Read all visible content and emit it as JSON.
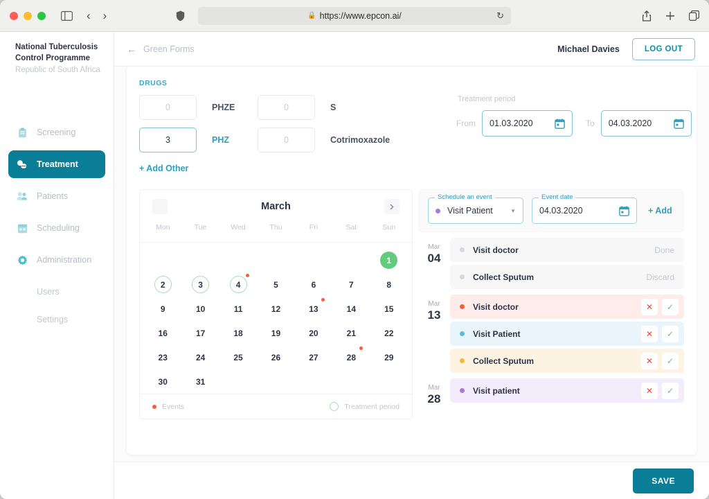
{
  "browser": {
    "url": "https://www.epcon.ai/",
    "lock_icon": "lock-icon",
    "shield_icon": "shield-icon",
    "sidebar_toggle_icon": "sidebar-toggle-icon",
    "back_icon": "chevron-left-icon",
    "forward_icon": "chevron-right-icon",
    "reload_icon": "reload-icon",
    "share_icon": "share-icon",
    "newtab_icon": "plus-icon",
    "tabs_icon": "tabs-icon"
  },
  "sidebar": {
    "brand_line1": "National Tuberculosis",
    "brand_line2": "Control Programme",
    "brand_sub": "Republic of South Africa",
    "items": [
      {
        "label": "Screening",
        "icon": "clipboard-icon",
        "active": false
      },
      {
        "label": "Treatment",
        "icon": "pills-icon",
        "active": true
      },
      {
        "label": "Patients",
        "icon": "users-icon",
        "active": false
      },
      {
        "label": "Scheduling",
        "icon": "calendar-icon",
        "active": false
      },
      {
        "label": "Administration",
        "icon": "gear-icon",
        "active": false
      }
    ],
    "subitems": [
      {
        "label": "Users"
      },
      {
        "label": "Settings"
      }
    ]
  },
  "topbar": {
    "back_label": "Green Forms",
    "back_icon": "arrow-left-icon",
    "username": "Michael Davies",
    "logout_label": "LOG OUT"
  },
  "drugs": {
    "section_label": "DRUGS",
    "rows": [
      {
        "value": "0",
        "placeholder": "0",
        "name": "PHZE",
        "filled": false,
        "accent": false
      },
      {
        "value": "3",
        "placeholder": "0",
        "name": "PHZ",
        "filled": true,
        "accent": true
      }
    ],
    "rows2": [
      {
        "value": "0",
        "placeholder": "0",
        "name": "S",
        "filled": false
      },
      {
        "value": "0",
        "placeholder": "0",
        "name": "Cotrimoxazole",
        "filled": false
      }
    ],
    "add_other_label": "+ Add Other"
  },
  "treatment_period": {
    "label": "Treatment period",
    "from_prefix": "From",
    "from_value": "01.03.2020",
    "to_prefix": "To",
    "to_value": "04.03.2020",
    "calendar_icon": "calendar-icon"
  },
  "calendar": {
    "month": "March",
    "prev_icon": "chevron-left-icon",
    "next_icon": "chevron-right-icon",
    "weekdays": [
      "Mon",
      "Tue",
      "Wed",
      "Thu",
      "Fri",
      "Sat",
      "Sun"
    ],
    "weeks": [
      [
        null,
        null,
        null,
        null,
        null,
        null,
        {
          "d": 1,
          "today": true,
          "range": false,
          "event": false
        }
      ],
      [
        {
          "d": 2,
          "range": true,
          "event": false
        },
        {
          "d": 3,
          "range": true,
          "event": false
        },
        {
          "d": 4,
          "range": true,
          "event": true
        },
        {
          "d": 5
        },
        {
          "d": 6
        },
        {
          "d": 7
        },
        {
          "d": 8
        }
      ],
      [
        {
          "d": 9
        },
        {
          "d": 10
        },
        {
          "d": 11
        },
        {
          "d": 12
        },
        {
          "d": 13,
          "event": true
        },
        {
          "d": 14
        },
        {
          "d": 15
        }
      ],
      [
        {
          "d": 16
        },
        {
          "d": 17
        },
        {
          "d": 18
        },
        {
          "d": 19
        },
        {
          "d": 20
        },
        {
          "d": 21
        },
        {
          "d": 22
        }
      ],
      [
        {
          "d": 23
        },
        {
          "d": 24
        },
        {
          "d": 25
        },
        {
          "d": 26
        },
        {
          "d": 27
        },
        {
          "d": 28,
          "event": true
        },
        {
          "d": 29
        }
      ],
      [
        {
          "d": 30
        },
        {
          "d": 31
        },
        null,
        null,
        null,
        null,
        null
      ]
    ],
    "legend_events": "Events",
    "legend_period": "Treatment period"
  },
  "schedule": {
    "event_label": "Schedule an event",
    "event_value": "Visit Patient",
    "event_dot_color": "#a77bdb",
    "date_label": "Event date",
    "date_value": "04.03.2020",
    "calendar_icon": "calendar-icon",
    "caret_icon": "chevron-down-icon",
    "add_label": "+ Add"
  },
  "event_groups": [
    {
      "month": "Mar",
      "day": "04",
      "events": [
        {
          "title": "Visit doctor",
          "status": "Done",
          "bg": "#f7f7f8",
          "dot": "#d5d8dc",
          "has_actions": false
        },
        {
          "title": "Collect Sputum",
          "status": "Discard",
          "bg": "#f7f7f8",
          "dot": "#d5d8dc",
          "has_actions": false
        }
      ]
    },
    {
      "month": "Mar",
      "day": "13",
      "events": [
        {
          "title": "Visit doctor",
          "status": "",
          "bg": "#fdecea",
          "dot": "#f0603c",
          "has_actions": true
        },
        {
          "title": "Visit Patient",
          "status": "",
          "bg": "#eaf4fb",
          "dot": "#5bbcd6",
          "has_actions": true
        },
        {
          "title": "Collect Sputum",
          "status": "",
          "bg": "#fdf3e3",
          "dot": "#f5b83d",
          "has_actions": true
        }
      ]
    },
    {
      "month": "Mar",
      "day": "28",
      "events": [
        {
          "title": "Visit patient",
          "status": "",
          "bg": "#f3edfb",
          "dot": "#a77bdb",
          "has_actions": true
        }
      ]
    }
  ],
  "actions": {
    "reject_icon": "close-icon",
    "accept_icon": "check-icon",
    "reject_glyph": "✕",
    "accept_glyph": "✓"
  },
  "footer": {
    "save_label": "SAVE"
  },
  "colors": {
    "accent_teal": "#0a7e96",
    "link_blue": "#2f9fbb",
    "today_green": "#63cb7d",
    "event_red": "#fb5d3b"
  }
}
